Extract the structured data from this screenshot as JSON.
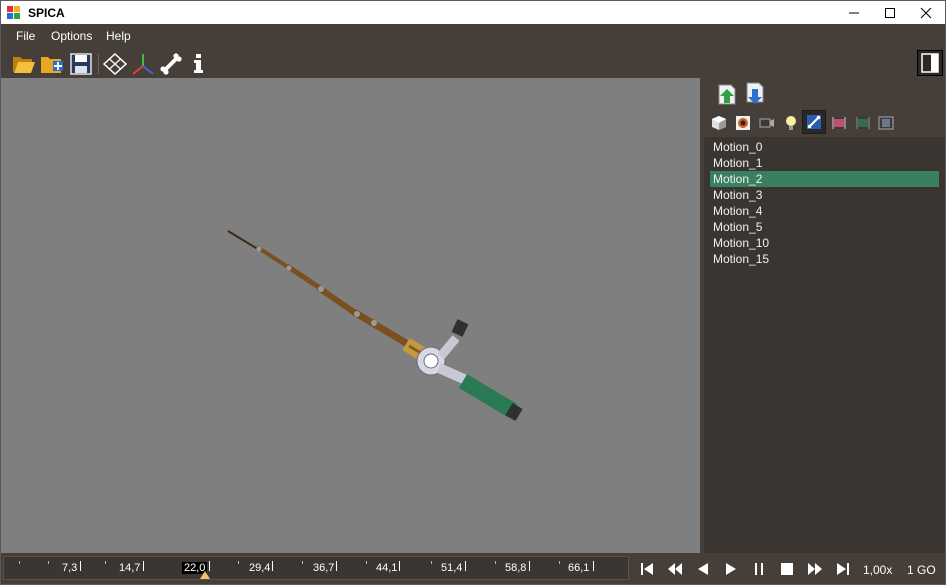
{
  "window": {
    "title": "SPICA"
  },
  "menu": {
    "items": [
      "File",
      "Options",
      "Help"
    ]
  },
  "motions": {
    "items": [
      "Motion_0",
      "Motion_1",
      "Motion_2",
      "Motion_3",
      "Motion_4",
      "Motion_5",
      "Motion_10",
      "Motion_15"
    ],
    "selected": "Motion_2"
  },
  "timeline": {
    "ticks": [
      "7,3",
      "14,7",
      "22,0",
      "29,4",
      "36,7",
      "44,1",
      "51,4",
      "58,8",
      "66,1"
    ],
    "current": "22,0"
  },
  "status": {
    "speed": "1,00x",
    "go": "1 GO"
  },
  "colors": {
    "background": "#453e39",
    "viewport": "#7f7f7f",
    "selection": "#3a8060"
  }
}
